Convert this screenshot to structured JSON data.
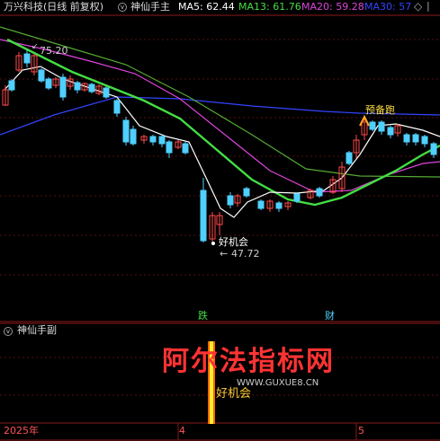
{
  "main_header": {
    "title": "万兴科技(日线 前复权)",
    "indicator": "神仙手主",
    "ma5": "MA5: 62.44",
    "ma13": "MA13: 61.76",
    "ma20": "MA20: 59.28",
    "ma30": "MA30: 57"
  },
  "annotations": {
    "high": "75.20",
    "low": "47.72",
    "buy_signal": "好机会",
    "ready_signal": "预备跑",
    "marker_die": "跌",
    "marker_cai": "财",
    "arrow": "←"
  },
  "sub_panel": {
    "title": "神仙手副",
    "signal_label": "好机会",
    "watermark": "阿尔法指标网",
    "watermark_url": "WWW.GUXUE8.CN"
  },
  "time_axis": {
    "labels": [
      "2025年",
      "4",
      "5"
    ]
  },
  "colors": {
    "up": "#ff4a4a",
    "down": "#4fd0ff",
    "ma5": "#ffffff",
    "ma13": "#44dd44",
    "ma20": "#dd44dd",
    "ma30": "#3344ff",
    "ma60": "#55aa33",
    "grid": "#551111"
  }
}
